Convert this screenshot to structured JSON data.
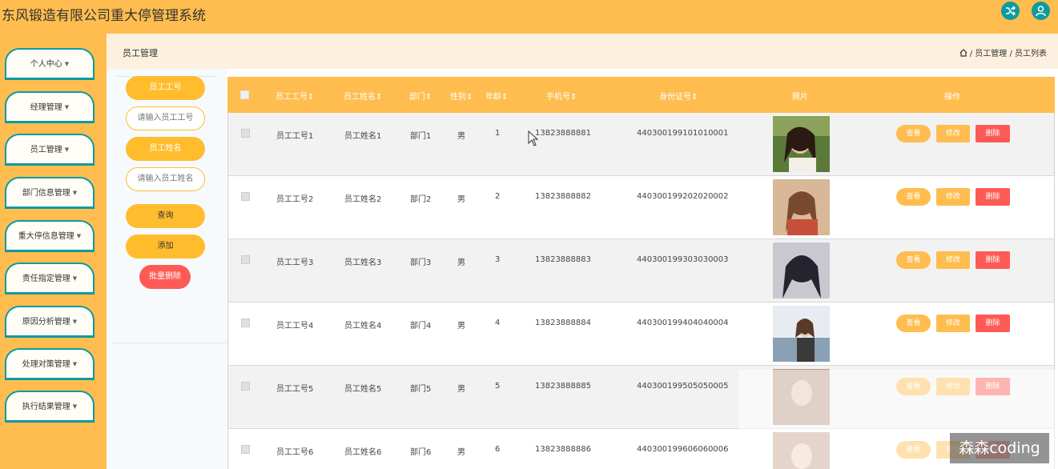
{
  "header": {
    "title": "东风锻造有限公司重大停管理系统",
    "icons": [
      "shuffle-icon",
      "user-icon"
    ],
    "accent": "#ffbd4f",
    "icon_color": "#0e9aa0"
  },
  "sidebar": {
    "items": [
      {
        "label": "个人中心"
      },
      {
        "label": "经理管理"
      },
      {
        "label": "员工管理"
      },
      {
        "label": "部门信息管理"
      },
      {
        "label": "重大停信息管理"
      },
      {
        "label": "责任指定管理"
      },
      {
        "label": "原因分析管理"
      },
      {
        "label": "处理对策管理"
      },
      {
        "label": "执行结果管理"
      }
    ]
  },
  "breadcrumb": {
    "title": "员工管理",
    "path": "/ 员工管理 / 员工列表"
  },
  "search": {
    "emp_no_label": "员工工号",
    "emp_no_placeholder": "请输入员工工号",
    "emp_name_label": "员工姓名",
    "emp_name_placeholder": "请输入员工姓名",
    "query_label": "查询",
    "add_label": "添加",
    "batch_delete_label": "批量删除"
  },
  "table": {
    "columns": [
      "员工工号",
      "员工姓名",
      "部门",
      "性别",
      "年龄",
      "手机号",
      "身份证号",
      "照片",
      "操作"
    ],
    "rows": [
      {
        "no": "员工工号1",
        "name": "员工姓名1",
        "dept": "部门1",
        "gender": "男",
        "age": "1",
        "phone": "13823888881",
        "id": "440300199101010001"
      },
      {
        "no": "员工工号2",
        "name": "员工姓名2",
        "dept": "部门2",
        "gender": "男",
        "age": "2",
        "phone": "13823888882",
        "id": "440300199202020002"
      },
      {
        "no": "员工工号3",
        "name": "员工姓名3",
        "dept": "部门3",
        "gender": "男",
        "age": "3",
        "phone": "13823888883",
        "id": "440300199303030003"
      },
      {
        "no": "员工工号4",
        "name": "员工姓名4",
        "dept": "部门4",
        "gender": "男",
        "age": "4",
        "phone": "13823888884",
        "id": "440300199404040004"
      },
      {
        "no": "员工工号5",
        "name": "员工姓名5",
        "dept": "部门5",
        "gender": "男",
        "age": "5",
        "phone": "13823888885",
        "id": "440300199505050005"
      },
      {
        "no": "员工工号6",
        "name": "员工姓名6",
        "dept": "部门6",
        "gender": "男",
        "age": "6",
        "phone": "13823888886",
        "id": "440300199606060006"
      }
    ],
    "actions": {
      "view": "查看",
      "edit": "修改",
      "delete": "删除"
    }
  },
  "watermark": "森森coding"
}
